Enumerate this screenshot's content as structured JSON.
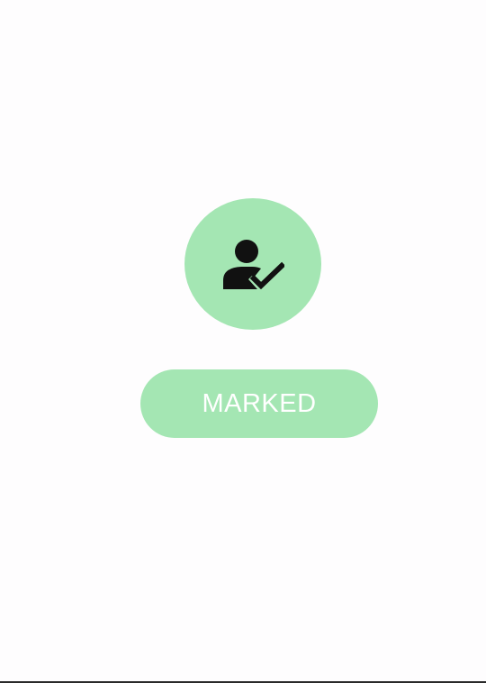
{
  "status": {
    "icon": "person-check-icon",
    "color": "#a4e6b3"
  },
  "action": {
    "label": "MARKED",
    "color": "#a4e6b3",
    "text_color": "#ffffff"
  },
  "background": "#fefdfe"
}
